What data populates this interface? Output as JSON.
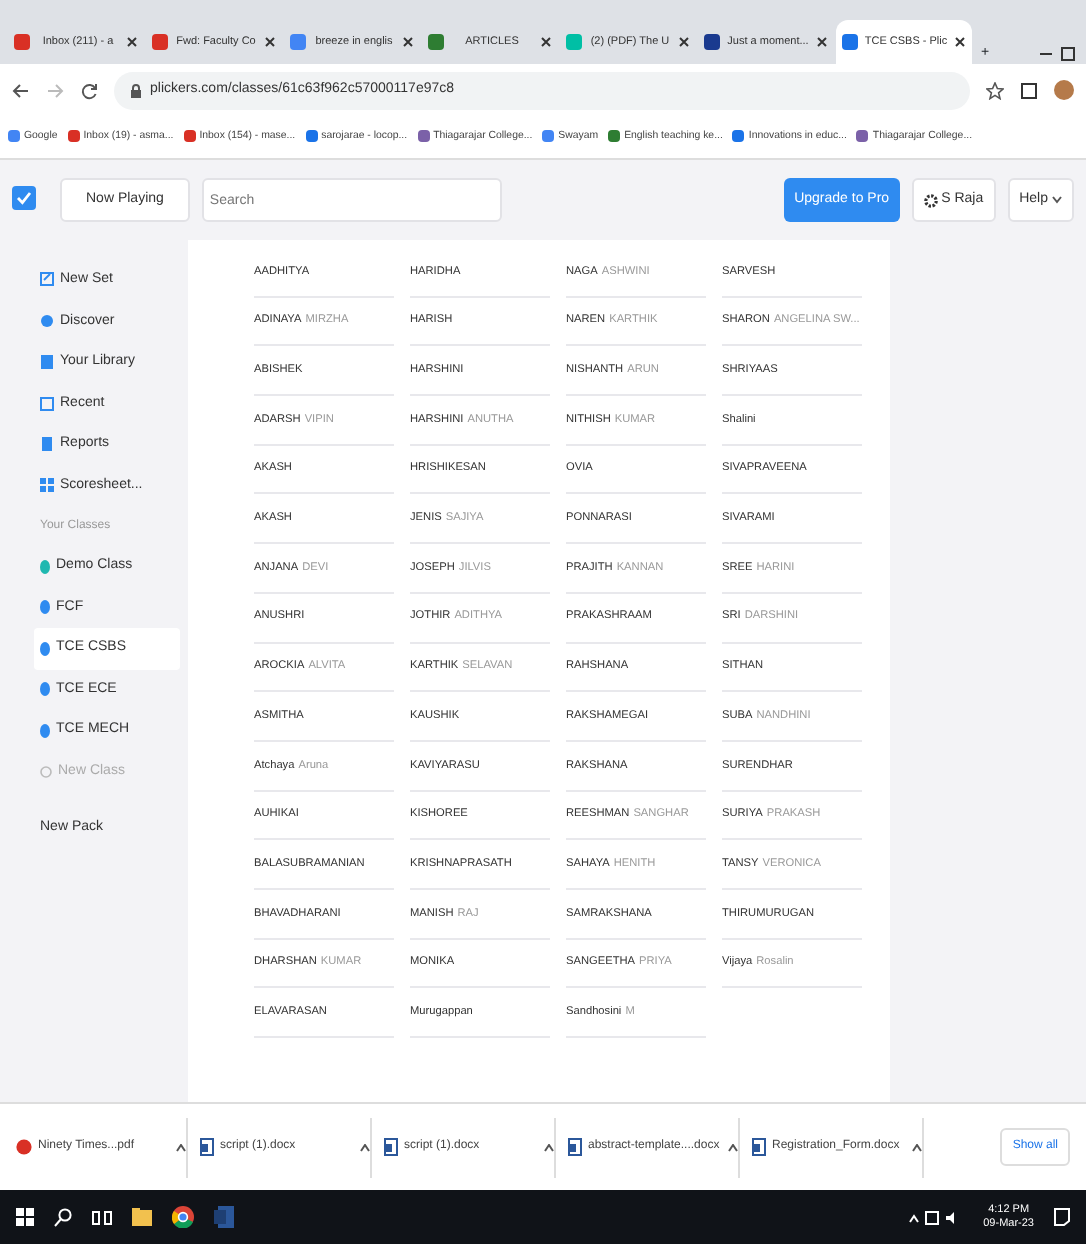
{
  "browser": {
    "tabs": [
      {
        "title": "Inbox (211) - a",
        "color": "#d93025",
        "selected": false
      },
      {
        "title": "Fwd: Faculty Co",
        "color": "#d93025",
        "selected": false
      },
      {
        "title": "breeze in englis",
        "color": "#4285f4",
        "selected": false
      },
      {
        "title": "ARTICLES",
        "color": "#2e7d32",
        "selected": false
      },
      {
        "title": "(2) (PDF) The U",
        "color": "#00bfa5",
        "selected": false
      },
      {
        "title": "Just a moment...",
        "color": "#1a3a8f",
        "selected": false
      },
      {
        "title": "TCE CSBS - Plic",
        "color": "#1a73e8",
        "selected": true
      }
    ],
    "new_tab": "+",
    "address": "plickers.com/classes/61c63f962c57000117e97c8",
    "bookmarks": [
      {
        "label": "Google",
        "color": "#4285f4"
      },
      {
        "label": "Inbox (19) - asma...",
        "color": "#d93025"
      },
      {
        "label": "Inbox (154) - mase...",
        "color": "#d93025"
      },
      {
        "label": "sarojarae - locop...",
        "color": "#1a73e8"
      },
      {
        "label": "Thiagarajar College...",
        "color": "#7b61a8"
      },
      {
        "label": "Swayam",
        "color": "#4285f4"
      },
      {
        "label": "English teaching ke...",
        "color": "#2e7d32"
      },
      {
        "label": "Innovations in educ...",
        "color": "#1a73e8"
      },
      {
        "label": "Thiagarajar College...",
        "color": "#7b61a8"
      }
    ]
  },
  "header": {
    "now_playing": "Now Playing",
    "search_placeholder": "Search",
    "upgrade": "Upgrade to Pro",
    "user": "S Raja",
    "help": "Help"
  },
  "sidebar": [
    {
      "kind": "nav",
      "label": "New Set"
    },
    {
      "kind": "nav",
      "label": "Discover"
    },
    {
      "kind": "nav",
      "label": "Your Library"
    },
    {
      "kind": "nav",
      "label": "Recent"
    },
    {
      "kind": "nav",
      "label": "Reports"
    },
    {
      "kind": "nav",
      "label": "Scoresheet..."
    },
    {
      "kind": "heading",
      "label": "Your Classes"
    },
    {
      "kind": "class",
      "label": "Demo Class",
      "color": "#1fb8b0",
      "selected": false
    },
    {
      "kind": "class",
      "label": "FCF",
      "color": "#2f8bf0",
      "selected": false
    },
    {
      "kind": "class",
      "label": "TCE CSBS",
      "color": "#2f8bf0",
      "selected": true
    },
    {
      "kind": "class",
      "label": "TCE ECE",
      "color": "#2f8bf0",
      "selected": false
    },
    {
      "kind": "class",
      "label": "TCE MECH",
      "color": "#2f8bf0",
      "selected": false
    },
    {
      "kind": "add",
      "label": "New Class"
    },
    {
      "kind": "pack",
      "label": "New Pack"
    }
  ],
  "roster": [
    {
      "first": "AADHITYA"
    },
    {
      "first": "HARIDHA"
    },
    {
      "first": "NAGA",
      "rest": "ASHWINI"
    },
    {
      "first": "SARVESH"
    },
    {
      "first": "ADINAYA",
      "rest": "MIRZHA"
    },
    {
      "first": "HARISH"
    },
    {
      "first": "NAREN",
      "rest": "KARTHIK"
    },
    {
      "first": "SHARON",
      "rest": "ANGELINA SW..."
    },
    {
      "first": "ABISHEK"
    },
    {
      "first": "HARSHINI"
    },
    {
      "first": "NISHANTH",
      "rest": "ARUN"
    },
    {
      "first": "SHRIYAAS"
    },
    {
      "first": "ADARSH",
      "rest": "VIPIN"
    },
    {
      "first": "HARSHINI",
      "rest": "ANUTHA"
    },
    {
      "first": "NITHISH",
      "rest": "KUMAR"
    },
    {
      "first": "Shalini"
    },
    {
      "first": "AKASH"
    },
    {
      "first": "HRISHIKESAN"
    },
    {
      "first": "OVIA"
    },
    {
      "first": "SIVAPRAVEENA"
    },
    {
      "first": "AKASH"
    },
    {
      "first": "JENIS",
      "rest": "SAJIYA"
    },
    {
      "first": "PONNARASI"
    },
    {
      "first": "SIVARAMI"
    },
    {
      "first": "ANJANA",
      "rest": "DEVI"
    },
    {
      "first": "JOSEPH",
      "rest": "JILVIS"
    },
    {
      "first": "PRAJITH",
      "rest": "KANNAN"
    },
    {
      "first": "SREE",
      "rest": "HARINI"
    },
    {
      "first": "ANUSHRI"
    },
    {
      "first": "JOTHIR",
      "rest": "ADITHYA"
    },
    {
      "first": "PRAKASHRAAM"
    },
    {
      "first": "SRI",
      "rest": "DARSHINI"
    },
    {
      "first": "AROCKIA",
      "rest": "ALVITA"
    },
    {
      "first": "KARTHIK",
      "rest": "SELAVAN"
    },
    {
      "first": "RAHSHANA"
    },
    {
      "first": "SITHAN"
    },
    {
      "first": "ASMITHA"
    },
    {
      "first": "KAUSHIK"
    },
    {
      "first": "RAKSHAMEGAI"
    },
    {
      "first": "SUBA",
      "rest": "NANDHINI"
    },
    {
      "first": "Atchaya",
      "rest": "Aruna"
    },
    {
      "first": "KAVIYARASU"
    },
    {
      "first": "RAKSHANA"
    },
    {
      "first": "SURENDHAR"
    },
    {
      "first": "AUHIKAI"
    },
    {
      "first": "KISHOREE"
    },
    {
      "first": "REESHMAN",
      "rest": "SANGHAR"
    },
    {
      "first": "SURIYA",
      "rest": "PRAKASH"
    },
    {
      "first": "BALASUBRAMANIAN"
    },
    {
      "first": "KRISHNAPRASATH"
    },
    {
      "first": "SAHAYA",
      "rest": "HENITH"
    },
    {
      "first": "TANSY",
      "rest": "VERONICA"
    },
    {
      "first": "BHAVADHARANI"
    },
    {
      "first": "MANISH",
      "rest": "RAJ"
    },
    {
      "first": "SAMRAKSHANA"
    },
    {
      "first": "THIRUMURUGAN"
    },
    {
      "first": "DHARSHAN",
      "rest": "KUMAR"
    },
    {
      "first": "MONIKA"
    },
    {
      "first": "SANGEETHA",
      "rest": "PRIYA"
    },
    {
      "first": "Vijaya",
      "rest": "Rosalin"
    },
    {
      "first": "ELAVARASAN"
    },
    {
      "first": "Murugappan"
    },
    {
      "first": "Sandhosini",
      "rest": "M"
    }
  ],
  "downloads": [
    {
      "name": "Ninety Times...pdf",
      "kind": "pdf"
    },
    {
      "name": "script (1).docx",
      "kind": "doc"
    },
    {
      "name": "script (1).docx",
      "kind": "doc"
    },
    {
      "name": "abstract-template....docx",
      "kind": "doc"
    },
    {
      "name": "Registration_Form.docx",
      "kind": "doc"
    }
  ],
  "show_all": "Show all",
  "taskbar": {
    "time": "4:12 PM",
    "date": "09-Mar-23"
  }
}
